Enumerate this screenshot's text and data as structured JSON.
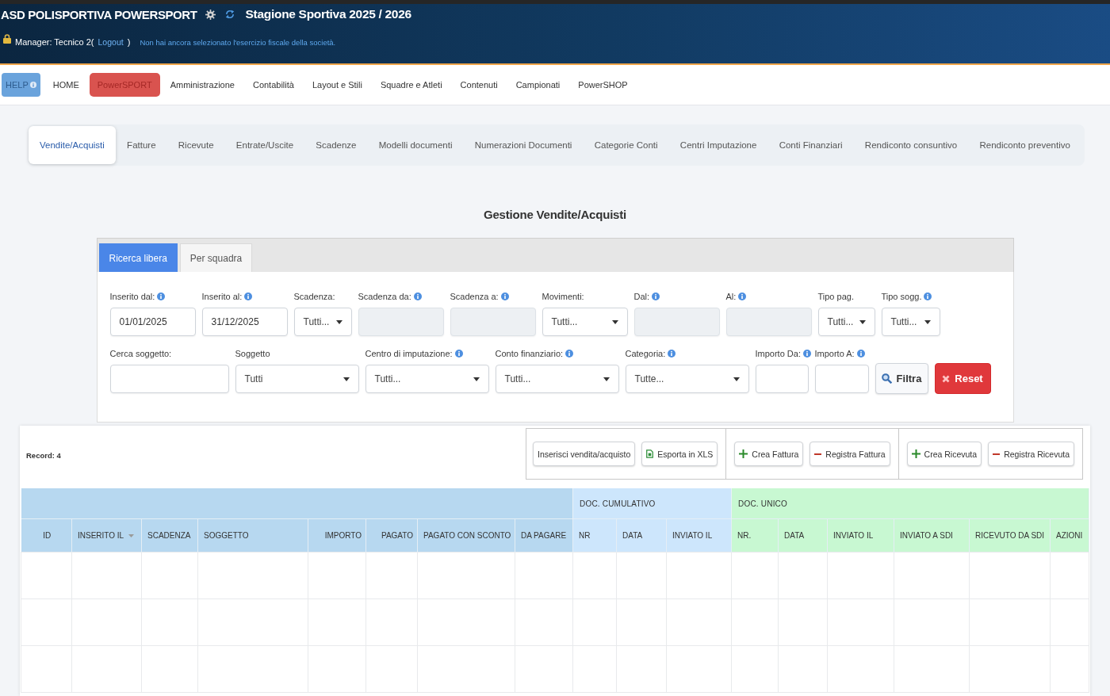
{
  "header": {
    "club": "ASD POLISPORTIVA POWERSPORT",
    "season": "Stagione Sportiva 2025 / 2026",
    "manager": {
      "before": "Manager: Tecnico 2(",
      "logout": "Logout",
      "after": ")"
    },
    "notice": "Non hai ancora selezionato l'esercizio fiscale della società."
  },
  "nav": [
    {
      "label": "HELP",
      "kind": "help",
      "selected": false
    },
    {
      "label": "HOME",
      "kind": "link",
      "selected": false
    },
    {
      "label": "PowerSPORT",
      "kind": "link",
      "selected": true
    },
    {
      "label": "Amministrazione",
      "kind": "link",
      "selected": false
    },
    {
      "label": "Contabilità",
      "kind": "link",
      "selected": false
    },
    {
      "label": "Layout e Stili",
      "kind": "link",
      "selected": false
    },
    {
      "label": "Squadre e Atleti",
      "kind": "link",
      "selected": false
    },
    {
      "label": "Contenuti",
      "kind": "link",
      "selected": false
    },
    {
      "label": "Campionati",
      "kind": "link",
      "selected": false
    },
    {
      "label": "PowerSHOP",
      "kind": "link",
      "selected": false
    }
  ],
  "section_tabs": [
    {
      "label": "Vendite/Acquisti",
      "selected": true
    },
    {
      "label": "Fatture",
      "selected": false
    },
    {
      "label": "Ricevute",
      "selected": false
    },
    {
      "label": "Entrate/Uscite",
      "selected": false
    },
    {
      "label": "Scadenze",
      "selected": false
    },
    {
      "label": "Modelli documenti",
      "selected": false
    },
    {
      "label": "Numerazioni Documenti",
      "selected": false
    },
    {
      "label": "Categorie Conti",
      "selected": false
    },
    {
      "label": "Centri Imputazione",
      "selected": false
    },
    {
      "label": "Conti Finanziari",
      "selected": false
    },
    {
      "label": "Rendiconto consuntivo",
      "selected": false
    },
    {
      "label": "Rendiconto preventivo",
      "selected": false
    }
  ],
  "page_title": "Gestione Vendite/Acquisti",
  "search": {
    "tabs": [
      {
        "label": "Ricerca libera",
        "selected": true
      },
      {
        "label": "Per squadra",
        "selected": false
      }
    ],
    "filter_lines": [
      {
        "fields": [
          {
            "label": "Inserito dal:",
            "info": true,
            "kind": "input",
            "value": "01/01/2025",
            "disabled": false
          },
          {
            "label": "Inserito al:",
            "info": true,
            "kind": "input",
            "value": "31/12/2025",
            "disabled": false
          },
          {
            "label": "Scadenza:",
            "info": false,
            "kind": "select",
            "value": "Tutti...",
            "disabled": false
          },
          {
            "label": "Scadenza da:",
            "info": true,
            "kind": "input",
            "disabled": true
          },
          {
            "label": "Scadenza a:",
            "info": true,
            "kind": "input",
            "disabled": true
          },
          {
            "label": "Movimenti:",
            "info": false,
            "kind": "select",
            "value": "Tutti...",
            "disabled": false
          },
          {
            "label": "Dal:",
            "info": true,
            "kind": "input",
            "disabled": true
          },
          {
            "label": "Al:",
            "info": true,
            "kind": "input",
            "disabled": true
          },
          {
            "label": "Tipo pag.",
            "info": false,
            "kind": "select",
            "value": "Tutti...",
            "disabled": false
          },
          {
            "label": "Tipo sogg.",
            "info": true,
            "kind": "select",
            "value": "Tutti...",
            "disabled": false
          }
        ]
      },
      {
        "fields": [
          {
            "label": "Cerca soggetto:",
            "info": false,
            "kind": "input",
            "disabled": false
          },
          {
            "label": "Soggetto",
            "info": false,
            "kind": "select",
            "value": "Tutti",
            "disabled": false
          },
          {
            "label": "Centro di imputazione:",
            "info": true,
            "kind": "select",
            "value": "Tutti...",
            "disabled": false
          },
          {
            "label": "Conto finanziario:",
            "info": true,
            "kind": "select",
            "value": "Tutti...",
            "disabled": false
          },
          {
            "label": "Categoria:",
            "info": true,
            "kind": "select",
            "value": "Tutte...",
            "disabled": false
          },
          {
            "label": "Importo Da:",
            "info": true,
            "kind": "input",
            "disabled": false
          },
          {
            "label": "Importo A:",
            "info": true,
            "kind": "input",
            "disabled": false
          }
        ]
      }
    ],
    "buttons": [
      {
        "label": "Filtra",
        "kind": "filter"
      },
      {
        "label": "Reset",
        "kind": "reset"
      }
    ]
  },
  "toolbar": {
    "record_count": "Record: 4",
    "groups": [
      [
        {
          "label": "Inserisci vendita/acquisto",
          "kind": "plain"
        },
        {
          "label": "Esporta in XLS",
          "kind": "xls"
        }
      ],
      [
        {
          "label": "Crea Fattura",
          "kind": "add"
        },
        {
          "label": "Registra Fattura",
          "kind": "remove"
        }
      ],
      [
        {
          "label": "Crea Ricevuta",
          "kind": "add"
        },
        {
          "label": "Registra Ricevuta",
          "kind": "remove"
        }
      ]
    ]
  },
  "table": {
    "groups": [
      {
        "color": "#b7d8f0",
        "columns": [
          {
            "label": "ID",
            "sorted": false
          },
          {
            "label": "INSERITO IL",
            "sorted": true
          },
          {
            "label": "SCADENZA",
            "sorted": false
          },
          {
            "label": "SOGGETTO",
            "sorted": false
          },
          {
            "label": "IMPORTO",
            "sorted": false
          },
          {
            "label": "PAGATO",
            "sorted": false
          },
          {
            "label": "PAGATO CON SCONTO",
            "sorted": false
          },
          {
            "label": "DA PAGARE",
            "sorted": false
          }
        ]
      },
      {
        "label": "DOC. CUMULATIVO",
        "color": "#cde6fc",
        "columns": [
          {
            "label": "NR",
            "sorted": false
          },
          {
            "label": "DATA",
            "sorted": false
          },
          {
            "label": "INVIATO IL",
            "sorted": false
          }
        ]
      },
      {
        "label": "DOC. UNICO",
        "color": "#c8f8d2",
        "columns": [
          {
            "label": "NR.",
            "sorted": false
          },
          {
            "label": "DATA",
            "sorted": false
          },
          {
            "label": "INVIATO IL",
            "sorted": false
          },
          {
            "label": "INVIATO A SDI",
            "sorted": false
          },
          {
            "label": "RICEVUTO DA SDI",
            "sorted": false
          },
          {
            "label": "AZIONI",
            "sorted": false
          }
        ]
      }
    ]
  }
}
